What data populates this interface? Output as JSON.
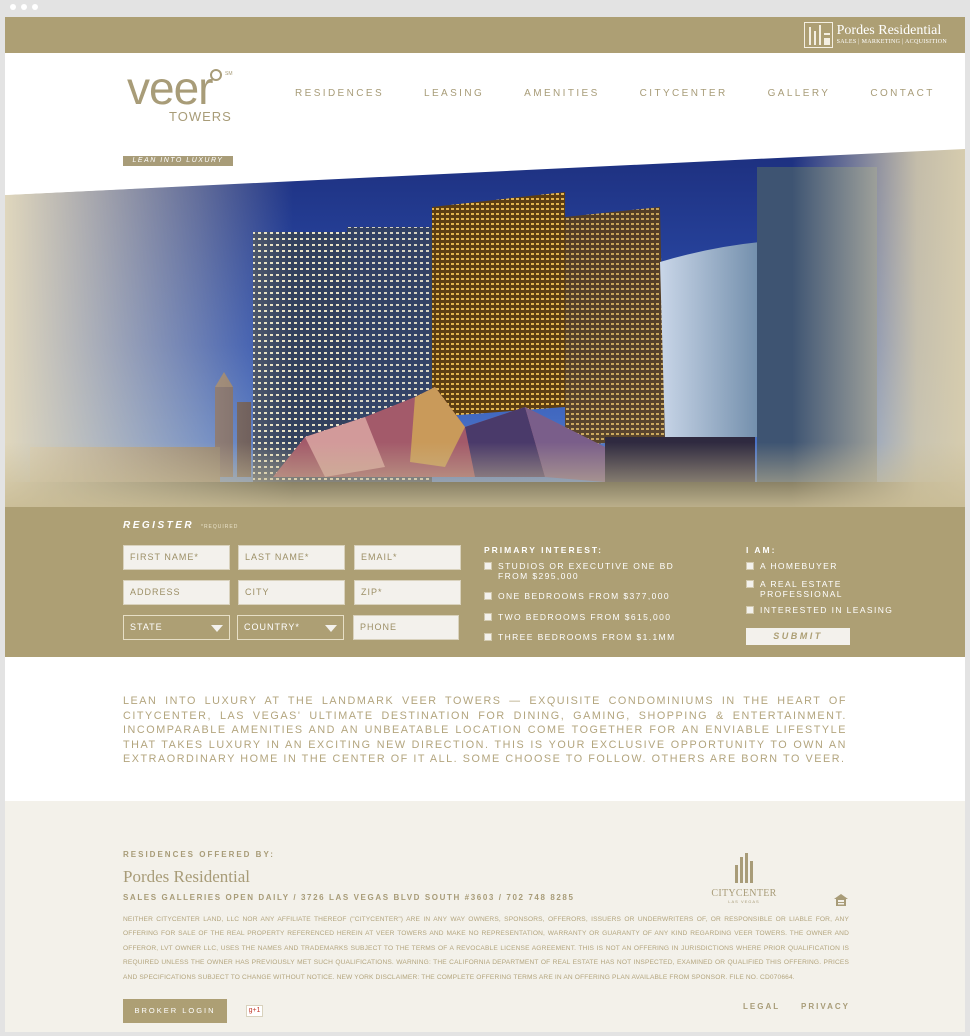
{
  "brand": {
    "pordes_name": "Pordes Residential",
    "pordes_tagline": "SALES | MARKETING | ACQUISITION",
    "veer_wordmark": "veer",
    "veer_sub": "TOWERS",
    "veer_mark": "SM"
  },
  "nav": {
    "items": [
      {
        "label": "RESIDENCES"
      },
      {
        "label": "LEASING"
      },
      {
        "label": "AMENITIES"
      },
      {
        "label": "CITYCENTER"
      },
      {
        "label": "GALLERY"
      },
      {
        "label": "CONTACT"
      }
    ]
  },
  "hero": {
    "tagline": "LEAN INTO LUXURY"
  },
  "register": {
    "title": "REGISTER",
    "required_note": "*REQUIRED",
    "fields": {
      "first_name": "FIRST NAME*",
      "last_name": "LAST NAME*",
      "email": "EMAIL*",
      "address": "ADDRESS",
      "city": "CITY",
      "zip": "ZIP*",
      "state": "STATE",
      "country": "COUNTRY*",
      "phone": "PHONE"
    },
    "primary_interest": {
      "title": "PRIMARY INTEREST:",
      "options": [
        "STUDIOS OR EXECUTIVE ONE BD FROM $295,000",
        "ONE BEDROOMS FROM $377,000",
        "TWO BEDROOMS FROM $615,000",
        "THREE BEDROOMS FROM $1.1MM"
      ]
    },
    "i_am": {
      "title": "I AM:",
      "options": [
        "A HOMEBUYER",
        "A REAL ESTATE PROFESSIONAL",
        "INTERESTED IN LEASING"
      ]
    },
    "submit_label": "SUBMIT"
  },
  "body_copy": "LEAN INTO LUXURY AT THE LANDMARK VEER TOWERS — EXQUISITE CONDOMINIUMS IN THE HEART OF CITYCENTER, LAS VEGAS' ULTIMATE DESTINATION  FOR DINING, GAMING, SHOPPING & ENTERTAINMENT. INCOMPARABLE AMENITIES AND AN UNBEATABLE LOCATION COME TOGETHER FOR AN ENVIABLE LIFESTYLE THAT TAKES LUXURY IN AN EXCITING NEW DIRECTION. THIS IS YOUR EXCLUSIVE OPPORTUNITY TO OWN AN EXTRAORDINARY HOME IN THE CENTER OF IT ALL. SOME CHOOSE TO FOLLOW. OTHERS ARE BORN TO VEER.",
  "footer": {
    "offered_label": "RESIDENCES OFFERED BY:",
    "offered_name": "Pordes Residential",
    "galleries": "SALES GALLERIES OPEN DAILY / 3726 LAS VEGAS BLVD SOUTH #3603 / 702 748 8285",
    "citycenter_name": "CITYCENTER",
    "citycenter_sub": "LAS VEGAS",
    "disclaimer": "NEITHER CITYCENTER LAND, LLC NOR ANY AFFILIATE THEREOF (\"CITYCENTER\") ARE IN ANY WAY OWNERS, SPONSORS, OFFERORS, ISSUERS OR UNDERWRITERS OF, OR RESPONSIBLE OR LIABLE FOR, ANY OFFERING FOR SALE OF THE REAL PROPERTY REFERENCED HEREIN AT VEER TOWERS AND MAKE NO REPRESENTATION, WARRANTY OR GUARANTY OF ANY KIND REGARDING VEER TOWERS. THE OWNER AND OFFEROR, LVT OWNER LLC, USES THE NAMES AND TRADEMARKS SUBJECT TO THE TERMS OF A REVOCABLE LICENSE AGREEMENT. THIS IS NOT AN OFFERING IN JURISDICTIONS WHERE PRIOR QUALIFICATION IS REQUIRED UNLESS THE OWNER HAS PREVIOUSLY MET SUCH QUALIFICATIONS. WARNING: THE CALIFORNIA DEPARTMENT OF REAL ESTATE HAS NOT INSPECTED, EXAMINED OR QUALIFIED THIS OFFERING. PRICES AND SPECIFICATIONS SUBJECT TO CHANGE WITHOUT NOTICE. NEW YORK DISCLAIMER: THE COMPLETE OFFERING TERMS ARE IN AN OFFERING PLAN AVAILABLE FROM SPONSOR. FILE NO. CD070664.",
    "broker_login": "BROKER LOGIN",
    "gplus": "g+1",
    "legal": "LEGAL",
    "privacy": "PRIVACY"
  },
  "colors": {
    "gold": "#ad9f74",
    "gold_text": "#a89c78",
    "cream": "#f3f1ea"
  }
}
